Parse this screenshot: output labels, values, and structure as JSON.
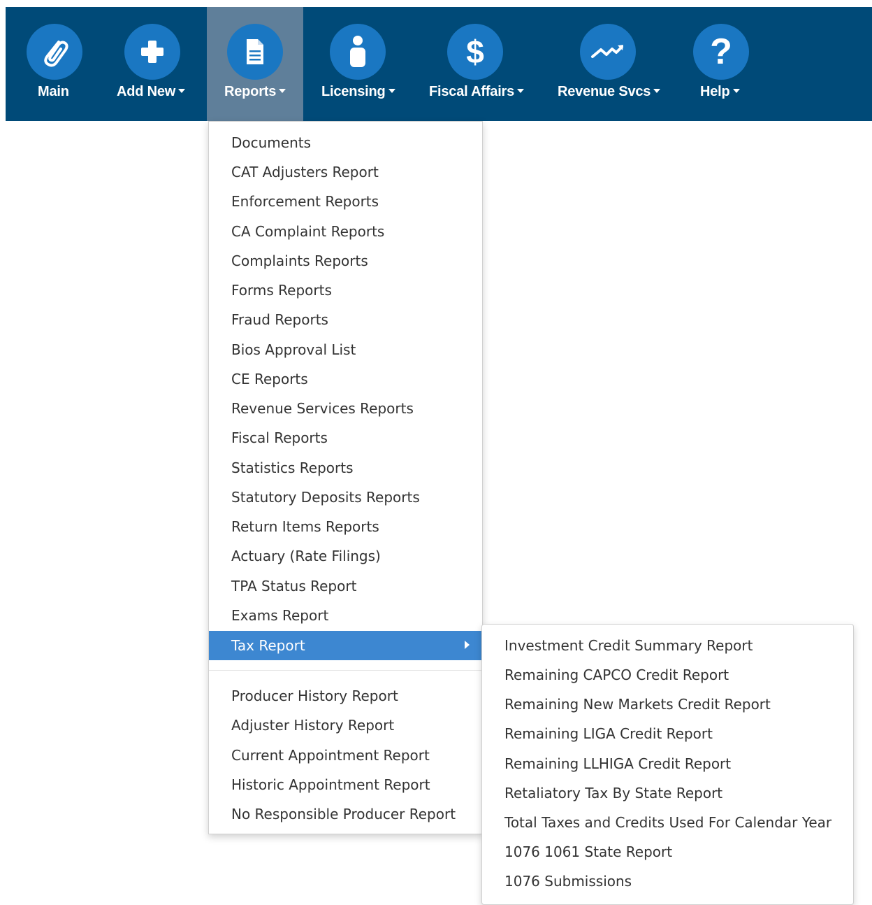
{
  "navbar": {
    "items": [
      {
        "label": "Main",
        "icon": "paperclip-icon",
        "caret": false
      },
      {
        "label": "Add New",
        "icon": "plus-icon",
        "caret": true
      },
      {
        "label": "Reports",
        "icon": "document-icon",
        "caret": true,
        "active": true
      },
      {
        "label": "Licensing",
        "icon": "person-icon",
        "caret": true
      },
      {
        "label": "Fiscal Affairs",
        "icon": "dollar-icon",
        "caret": true
      },
      {
        "label": "Revenue Svcs",
        "icon": "trend-icon",
        "caret": true
      },
      {
        "label": "Help",
        "icon": "question-icon",
        "caret": true
      }
    ]
  },
  "reports_menu": {
    "items": [
      "Documents",
      "CAT Adjusters Report",
      "Enforcement Reports",
      "CA Complaint Reports",
      "Complaints Reports",
      "Forms Reports",
      "Fraud Reports",
      "Bios Approval List",
      "CE Reports",
      "Revenue Services Reports",
      "Fiscal Reports",
      "Statistics Reports",
      "Statutory Deposits Reports",
      "Return Items Reports",
      "Actuary (Rate Filings)",
      "TPA Status Report",
      "Exams Report",
      "Tax Report"
    ],
    "highlighted": "Tax Report",
    "secondary_items": [
      "Producer History Report",
      "Adjuster History Report",
      "Current Appointment Report",
      "Historic Appointment Report",
      "No Responsible Producer Report"
    ]
  },
  "tax_submenu": {
    "items": [
      "Investment Credit Summary Report",
      "Remaining CAPCO Credit Report",
      "Remaining New Markets Credit Report",
      "Remaining LIGA Credit Report",
      "Remaining LLHIGA Credit Report",
      "Retaliatory Tax By State Report",
      "Total Taxes and Credits Used For Calendar Year",
      "1076 1061 State Report",
      "1076 Submissions"
    ]
  },
  "colors": {
    "navbar": "#004a78",
    "icon_circle": "#1a77c2",
    "active_tab": "#5f7f9a",
    "highlight": "#3d87d1"
  }
}
